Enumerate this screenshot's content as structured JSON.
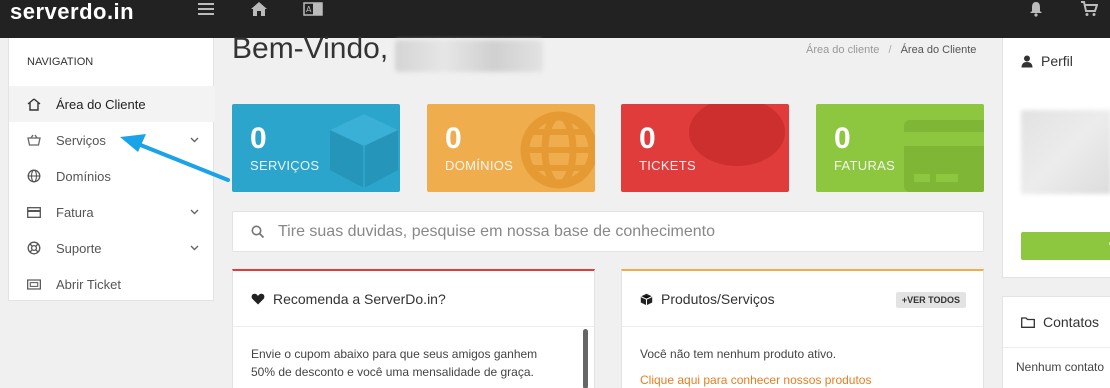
{
  "header": {
    "logo": "serverdo.in"
  },
  "sidebar": {
    "title": "NAVIGATION",
    "items": [
      {
        "label": "Área do Cliente",
        "icon": "home-icon"
      },
      {
        "label": "Serviços",
        "icon": "basket-icon"
      },
      {
        "label": "Domínios",
        "icon": "globe-icon"
      },
      {
        "label": "Fatura",
        "icon": "credit-card-icon"
      },
      {
        "label": "Suporte",
        "icon": "lifebuoy-icon"
      },
      {
        "label": "Abrir Ticket",
        "icon": "ticket-icon"
      }
    ]
  },
  "main": {
    "welcome": "Bem-Vindo,",
    "breadcrumb": {
      "parent": "Área do cliente",
      "separator": "/",
      "current": "Área do Cliente"
    },
    "tiles": [
      {
        "value": "0",
        "label": "SERVIÇOS",
        "color": "#2ba5cc"
      },
      {
        "value": "0",
        "label": "DOMÍNIOS",
        "color": "#f0ad4e"
      },
      {
        "value": "0",
        "label": "TICKETS",
        "color": "#e03c3c"
      },
      {
        "value": "0",
        "label": "FATURAS",
        "color": "#8dc63f"
      }
    ],
    "search_placeholder": "Tire suas duvidas, pesquise em nossa base de conhecimento",
    "panels": {
      "recommend": {
        "title": "Recomenda a ServerDo.in?",
        "text_line1": "Envie o cupom abaixo para que seus amigos ganhem",
        "text_line2": "50% de desconto e você uma mensalidade de graça."
      },
      "products": {
        "title": "Produtos/Serviços",
        "button": "VER TODOS",
        "text": "Você não tem nenhum produto ativo.",
        "link": "Clique aqui para conhecer nossos produtos"
      }
    }
  },
  "right": {
    "profile_title": "Perfil",
    "contacts_title": "Contatos",
    "contacts_text": "Nenhum contato"
  },
  "colors": {
    "topbar": "#222222",
    "accent_red": "#e03c3c",
    "accent_orange": "#f0ad4e",
    "arrow": "#1aa3e8"
  }
}
